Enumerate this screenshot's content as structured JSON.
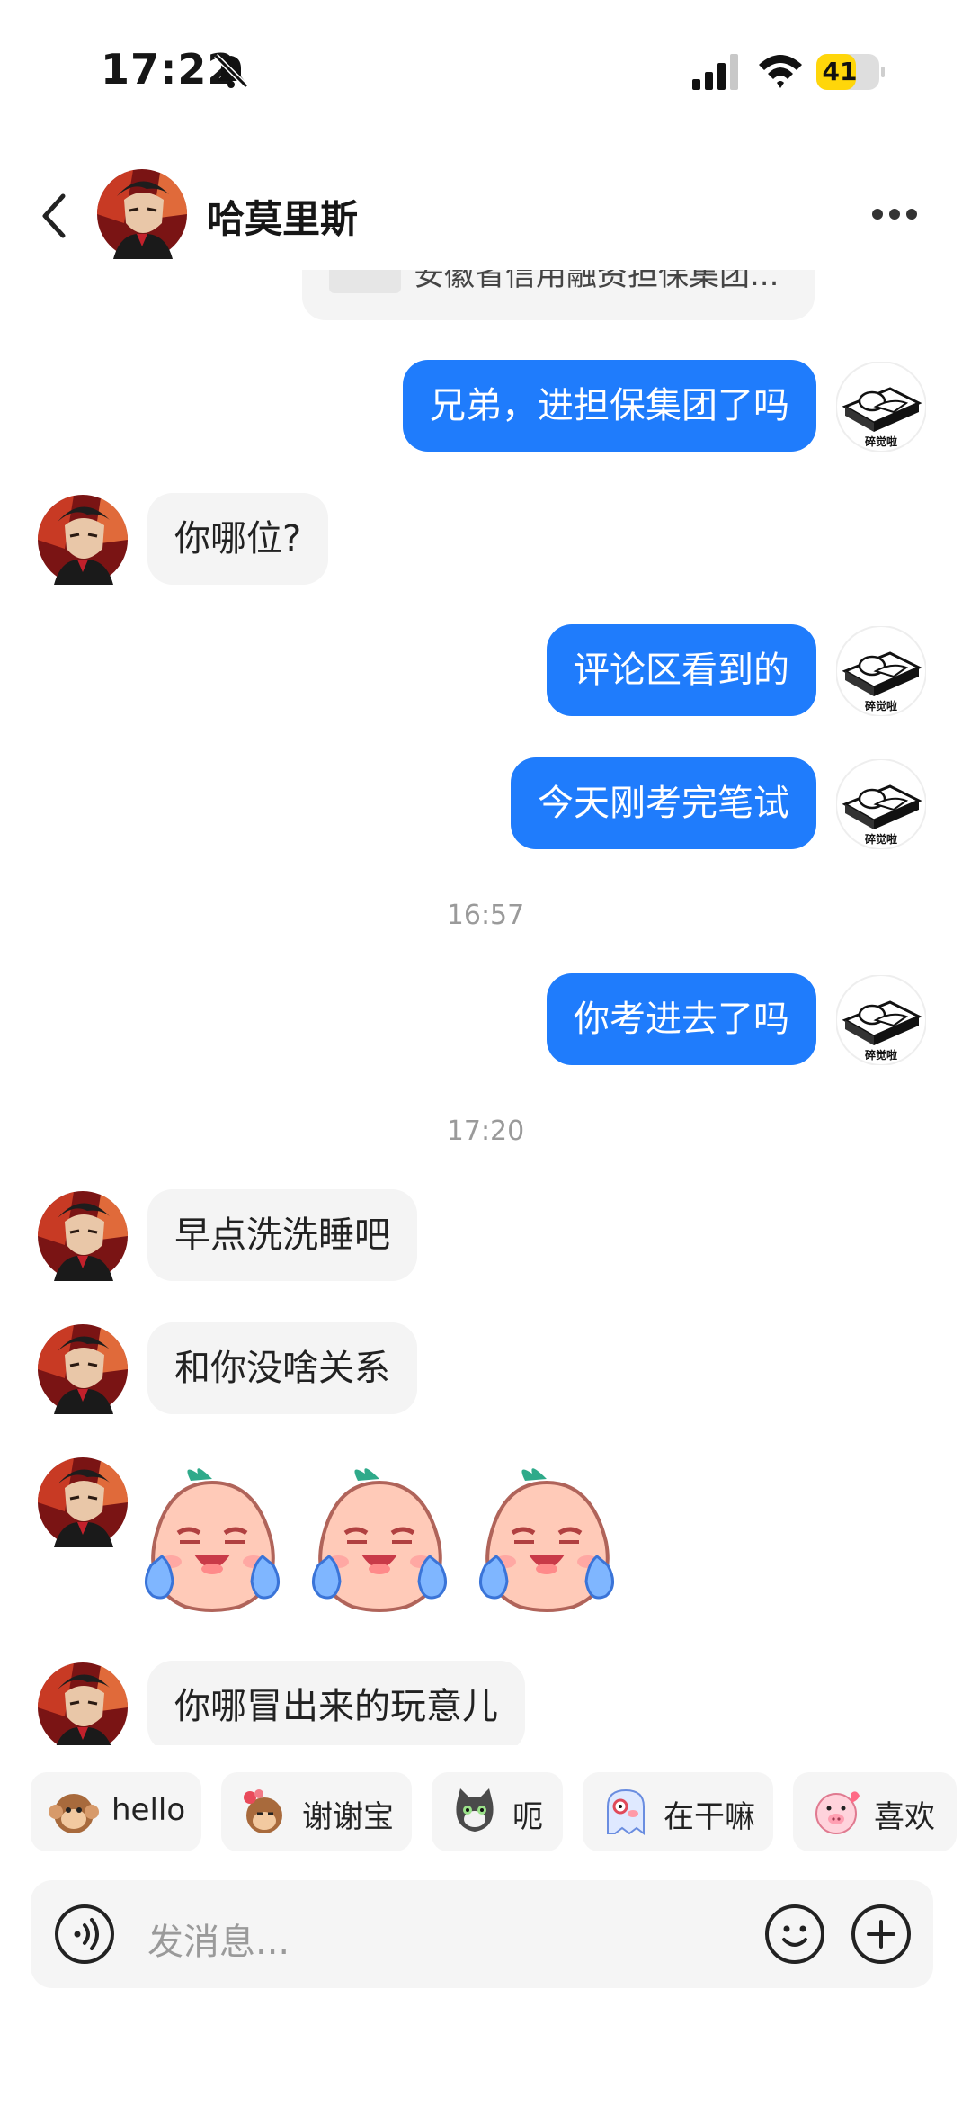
{
  "status_bar": {
    "time": "17:22",
    "battery": "41"
  },
  "header": {
    "contact_name": "哈莫里斯"
  },
  "chat": {
    "partial_card_text": "安徽省信用融资担保集团...",
    "messages": [
      {
        "from": "me",
        "text": "兄弟，进担保集团了吗"
      },
      {
        "from": "other",
        "text": "你哪位?"
      },
      {
        "from": "me",
        "text": "评论区看到的"
      },
      {
        "from": "me",
        "text": "今天刚考完笔试"
      },
      {
        "from": "me",
        "text": "你考进去了吗"
      },
      {
        "from": "other",
        "text": "早点洗洗睡吧"
      },
      {
        "from": "other",
        "text": "和你没啥关系"
      },
      {
        "from": "other",
        "text": "你哪冒出来的玩意儿"
      }
    ],
    "timestamps": [
      "16:57",
      "17:20"
    ],
    "my_avatar_caption": "碎觉啦"
  },
  "quick_replies": [
    "hello",
    "谢谢宝",
    "呃",
    "在干嘛",
    "喜欢"
  ],
  "input": {
    "placeholder": "发消息..."
  },
  "colors": {
    "accent": "#1f7cfc",
    "bubble_in": "#f4f4f4"
  },
  "icons": [
    "back-icon",
    "more-icon",
    "voice-icon",
    "emoji-icon",
    "plus-icon",
    "mute-bell-icon",
    "signal-icon",
    "wifi-icon"
  ]
}
